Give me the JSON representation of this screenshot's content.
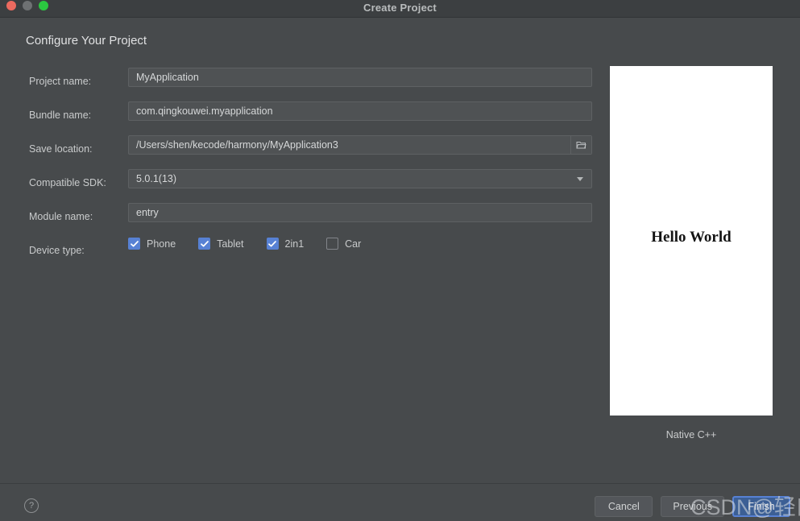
{
  "window": {
    "title": "Create Project",
    "traffic_lights": [
      "close-button",
      "minimize-button",
      "maximize-button"
    ]
  },
  "heading": "Configure Your Project",
  "form": {
    "fields": [
      {
        "label": "Project name:",
        "value": "MyApplication",
        "type": "text"
      },
      {
        "label": "Bundle name:",
        "value": "com.qingkouwei.myapplication",
        "type": "text"
      },
      {
        "label": "Save location:",
        "value": "/Users/shen/kecode/harmony/MyApplication3",
        "type": "path",
        "browse_icon": "folder-icon"
      },
      {
        "label": "Compatible SDK:",
        "value": "5.0.1(13)",
        "type": "select",
        "caret_icon": "chevron-down-icon"
      },
      {
        "label": "Module name:",
        "value": "entry",
        "type": "text"
      }
    ],
    "device_type": {
      "label": "Device type:",
      "options": [
        {
          "label": "Phone",
          "checked": true
        },
        {
          "label": "Tablet",
          "checked": true
        },
        {
          "label": "2in1",
          "checked": true
        },
        {
          "label": "Car",
          "checked": false
        }
      ]
    }
  },
  "preview": {
    "screen_text": "Hello World",
    "caption": "Native C++"
  },
  "footer": {
    "help_icon": "help-circle-icon",
    "help_glyph": "?",
    "buttons": [
      {
        "label": "Cancel",
        "style": "normal"
      },
      {
        "label": "Previous",
        "style": "normal"
      },
      {
        "label": "Finish",
        "style": "primary"
      }
    ]
  },
  "watermark": {
    "text": "CSDN@轻口味"
  },
  "colors": {
    "titlebar": "#3c3f41",
    "dialog": "#474a4c",
    "field": "#4f5254",
    "accent": "#5781d4",
    "text": "#c9cbcc"
  }
}
